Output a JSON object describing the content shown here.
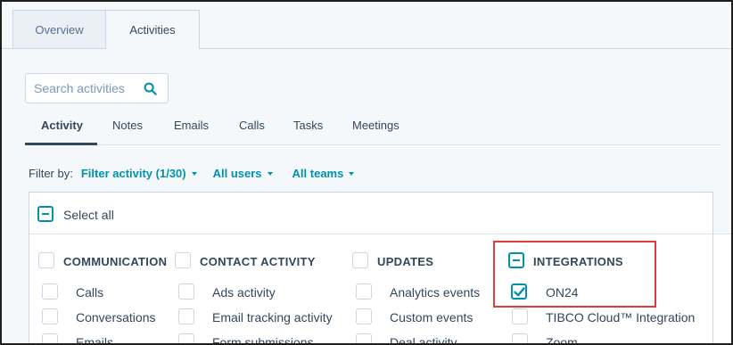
{
  "top_tabs": {
    "overview": "Overview",
    "activities": "Activities"
  },
  "search": {
    "placeholder": "Search activities"
  },
  "sub_tabs": [
    "Activity",
    "Notes",
    "Emails",
    "Calls",
    "Tasks",
    "Meetings"
  ],
  "filter": {
    "label": "Filter by:",
    "activity": "Filter activity (1/30)",
    "users": "All users",
    "teams": "All teams"
  },
  "select_all": "Select all",
  "columns": [
    {
      "header": "COMMUNICATION",
      "items": [
        "Calls",
        "Conversations",
        "Emails"
      ]
    },
    {
      "header": "CONTACT ACTIVITY",
      "items": [
        "Ads activity",
        "Email tracking activity",
        "Form submissions"
      ]
    },
    {
      "header": "UPDATES",
      "items": [
        "Analytics events",
        "Custom events",
        "Deal activity"
      ]
    },
    {
      "header": "INTEGRATIONS",
      "items": [
        "ON24",
        "TIBCO Cloud™ Integration",
        "Zoom"
      ]
    }
  ],
  "colors": {
    "accent": "#0091ae",
    "highlight": "#e03c3c",
    "text": "#33475b"
  }
}
